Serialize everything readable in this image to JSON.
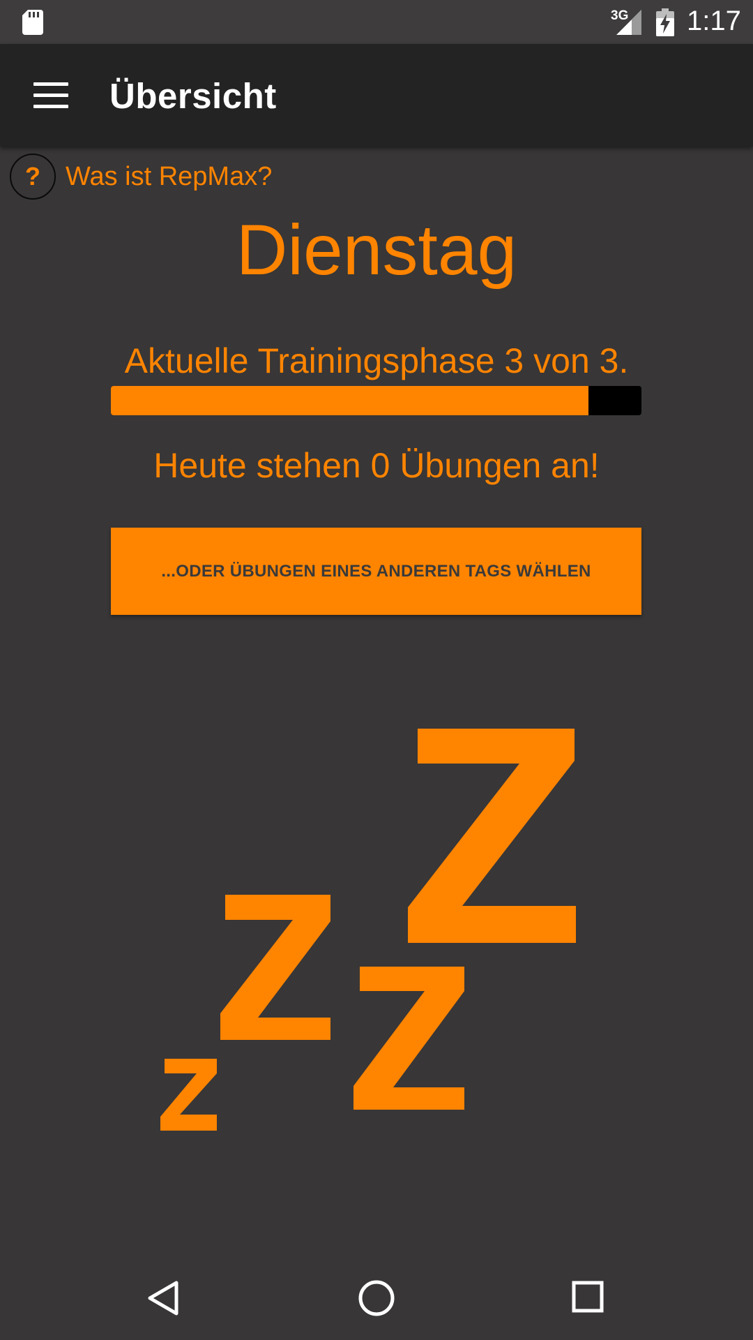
{
  "status_bar": {
    "network_type": "3G",
    "time": "1:17",
    "icons": [
      "sd-card-icon",
      "signal-icon",
      "battery-charging-icon"
    ]
  },
  "toolbar": {
    "title": "Übersicht",
    "menu_icon": "hamburger-menu-icon"
  },
  "help": {
    "icon_glyph": "?",
    "label": "Was ist RepMax?"
  },
  "main": {
    "day_name": "Dienstag",
    "phase_text": "Aktuelle Trainingsphase 3 von 3.",
    "phase_progress": 0.9,
    "today_text": "Heute stehen 0 Übungen an!",
    "other_day_button": "...ODER ÜBUNGEN EINES ANDEREN TAGS WÄHLEN",
    "illustration": "sleeping-zzz-icon"
  },
  "nav_bar": {
    "icons": [
      "back-icon",
      "home-icon",
      "recents-icon"
    ]
  },
  "colors": {
    "accent": "#ff8400",
    "background": "#383636",
    "toolbar": "#232323",
    "status_bar": "#3e3c3c",
    "progress_track": "#000000"
  }
}
